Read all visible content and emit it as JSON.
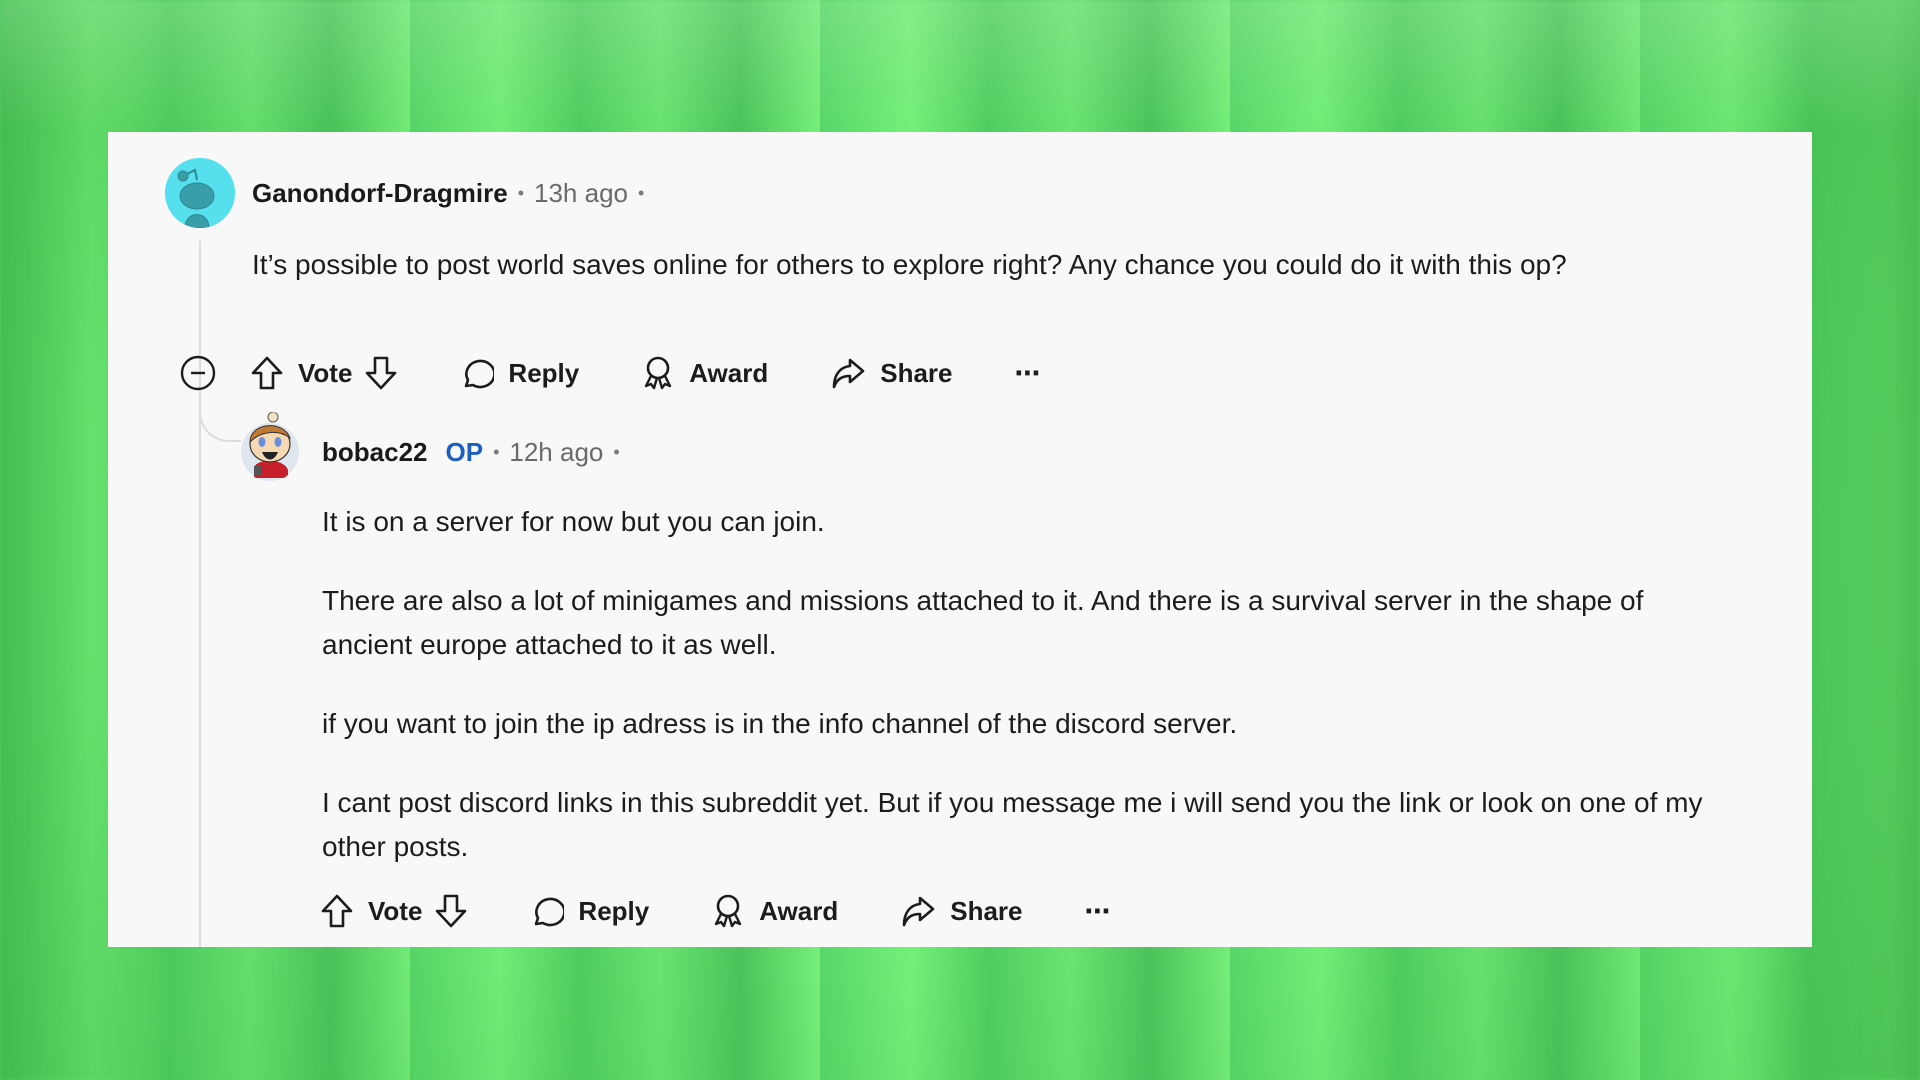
{
  "theme": {
    "op_color": "#1b5fc1",
    "avatar1_color": "#56e0ee",
    "card_bg": "#f8f8f8",
    "background_color": "#6fe877"
  },
  "comments": [
    {
      "username": "Ganondorf-Dragmire",
      "time": "13h ago",
      "separator": "•",
      "avatar_icon": "snoo-avatar-icon",
      "body": [
        "It’s possible to post world saves online for others to explore right? Any chance you could do it with this op?"
      ],
      "actions": {
        "collapse_icon": "collapse-icon",
        "vote": "Vote",
        "reply": "Reply",
        "award": "Award",
        "share": "Share",
        "more": "⋯"
      }
    },
    {
      "username": "bobac22",
      "badge": "OP",
      "time": "12h ago",
      "separator": "•",
      "avatar_icon": "custom-avatar-icon",
      "body": [
        "It is on a server for now but you can join.",
        "There are also a lot of minigames and missions attached to it. And there is a survival server in the shape of ancient europe attached to it as well.",
        "if you want to join the ip adress is in the info channel of the discord server.",
        "I cant post discord links in this subreddit yet. But if you message me i will send you the link or look on one of my other posts."
      ],
      "actions": {
        "vote": "Vote",
        "reply": "Reply",
        "award": "Award",
        "share": "Share",
        "more": "⋯"
      }
    }
  ]
}
